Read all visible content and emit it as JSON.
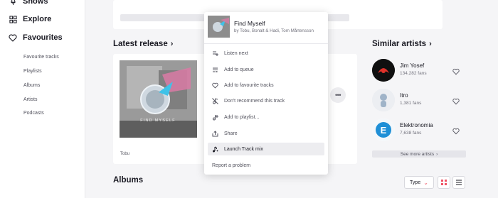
{
  "sidebar": {
    "shows": "Shows",
    "explore": "Explore",
    "favourites": "Favourites",
    "sub_items": [
      "Favourite tracks",
      "Playlists",
      "Albums",
      "Artists",
      "Podcasts"
    ]
  },
  "latest_release": {
    "title": "Latest release",
    "artist": "Tobu",
    "cover_text": "FIND MYSELF"
  },
  "similar_artists": {
    "title": "Similar artists",
    "artists": [
      {
        "name": "Jim Yosef",
        "fans": "134,282 fans"
      },
      {
        "name": "Itro",
        "fans": "1,381 fans"
      },
      {
        "name": "Elektronomia",
        "fans": "7,638 fans"
      }
    ],
    "see_more": "See more artists"
  },
  "albums": {
    "title": "Albums",
    "type_label": "Type"
  },
  "context_menu": {
    "track_title": "Find Myself",
    "track_artists": "by Tobu, Bonalt & Hadi, Tom Mårtensson",
    "items": [
      {
        "label": "Listen next",
        "icon": "listen-next-icon"
      },
      {
        "label": "Add to queue",
        "icon": "queue-icon"
      },
      {
        "label": "Add to favourite tracks",
        "icon": "heart-icon"
      },
      {
        "label": "Don't recommend this track",
        "icon": "dont-recommend-icon"
      },
      {
        "label": "Add to playlist...",
        "icon": "playlist-add-icon"
      },
      {
        "label": "Share",
        "icon": "share-icon"
      },
      {
        "label": "Launch Track mix",
        "icon": "track-mix-icon"
      },
      {
        "label": "Report a problem",
        "icon": ""
      }
    ]
  },
  "colors": {
    "accent": "#ef5466",
    "background": "#f5f5f7",
    "highlight": "#ededf0"
  }
}
